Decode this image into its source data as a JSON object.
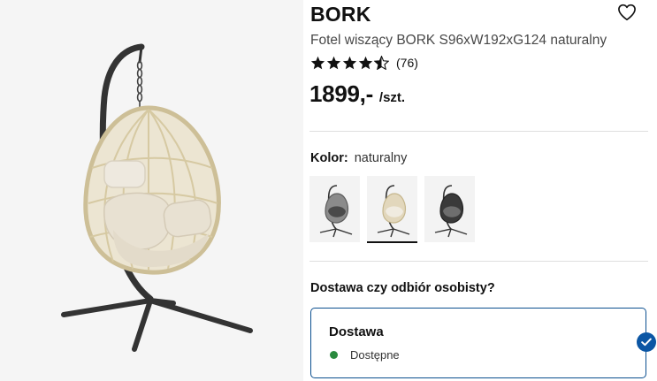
{
  "product": {
    "brand": "BORK",
    "subtitle": "Fotel wiszący BORK S96xW192xG124 naturalny",
    "rating": 4.5,
    "rating_count": "(76)",
    "price": "1899,-",
    "price_unit": "/szt."
  },
  "color": {
    "label": "Kolor:",
    "value": "naturalny",
    "swatches": [
      {
        "name": "szary",
        "selected": false
      },
      {
        "name": "naturalny",
        "selected": true
      },
      {
        "name": "czarny",
        "selected": false
      }
    ]
  },
  "delivery": {
    "question": "Dostawa czy odbiór osobisty?",
    "option_title": "Dostawa",
    "option_status": "Dostępne",
    "status_color": "#2a8a3e",
    "selected": true
  },
  "colors": {
    "accent": "#0b56a4",
    "rattan": "#d8cba8",
    "cushion": "#ece6d8",
    "frame": "#333333"
  },
  "icons": {
    "wishlist": "heart-outline-icon",
    "selected": "checkmark-icon",
    "rating": "star-icon"
  }
}
